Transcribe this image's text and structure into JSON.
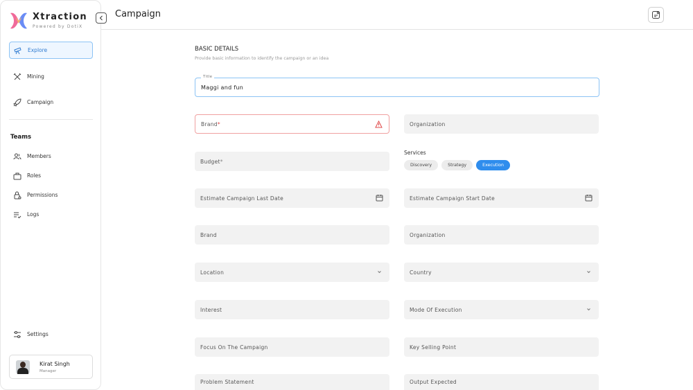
{
  "app": {
    "name": "Xtraction",
    "tagline": "Powered by DotiX"
  },
  "sidebar": {
    "items": [
      {
        "label": "Explore",
        "icon": "telescope-icon",
        "active": true
      },
      {
        "label": "Mining",
        "icon": "tools-icon"
      },
      {
        "label": "Campaign",
        "icon": "rocket-icon"
      }
    ],
    "teams_title": "Teams",
    "team_items": [
      {
        "label": "Members",
        "icon": "users-icon"
      },
      {
        "label": "Roles",
        "icon": "briefcase-icon"
      },
      {
        "label": "Permissions",
        "icon": "lock-icon"
      },
      {
        "label": "Logs",
        "icon": "list-icon"
      }
    ],
    "settings_label": "Settings",
    "user": {
      "name": "Kirat Singh",
      "role": "Manager"
    }
  },
  "header": {
    "title": "Campaign"
  },
  "form": {
    "heading": "BASIC DETAILS",
    "subheading": "Provide basic information to identify the campaign or an idea",
    "title_label": "Title",
    "title_value": "Maggi and fun",
    "brand_label": "Brand",
    "brand_required": "*",
    "organization_label": "Organization",
    "budget_label": "Budget",
    "budget_required": "*",
    "services_label": "Services",
    "services": [
      {
        "label": "Discovery",
        "selected": false
      },
      {
        "label": "Strategy",
        "selected": false
      },
      {
        "label": "Execution",
        "selected": true
      }
    ],
    "est_last_date_label": "Estimate Campaign Last Date",
    "est_start_date_label": "Estimate Campaign Start Date",
    "brand2_label": "Brand",
    "organization2_label": "Organization",
    "location_label": "Location",
    "country_label": "Country",
    "interest_label": "Interest",
    "mode_label": "Mode Of Execution",
    "focus_label": "Focus On The Campaign",
    "ksp_label": "Key Selling Point",
    "problem_label": "Problem Statement",
    "output_label": "Output Expected"
  },
  "colors": {
    "accent": "#2f8ded",
    "error": "#e04848",
    "field_bg": "#f2f2f2"
  }
}
